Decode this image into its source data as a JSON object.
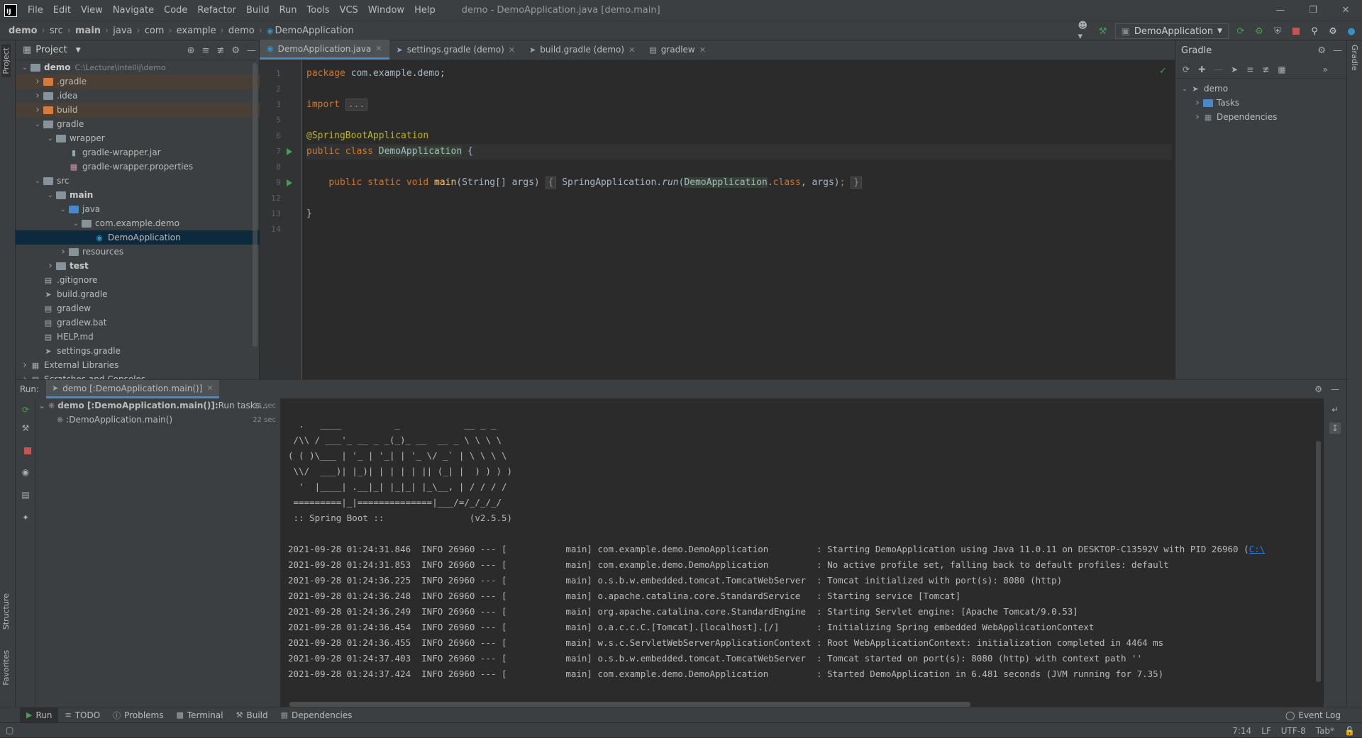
{
  "app": {
    "window_title": "demo - DemoApplication.java [demo.main]"
  },
  "menu": [
    "File",
    "Edit",
    "View",
    "Navigate",
    "Code",
    "Refactor",
    "Build",
    "Run",
    "Tools",
    "VCS",
    "Window",
    "Help"
  ],
  "breadcrumb": [
    "demo",
    "src",
    "main",
    "java",
    "com",
    "example",
    "demo",
    "DemoApplication"
  ],
  "run_config": "DemoApplication",
  "project_panel": {
    "title": "Project",
    "tree": [
      {
        "label": "demo",
        "path": "C:\\Lecture\\intellij\\demo",
        "depth": 0,
        "arrow": "down",
        "icon": "module-folder-icon",
        "bold": true
      },
      {
        "label": ".gradle",
        "depth": 1,
        "arrow": "right",
        "icon": "excluded-folder-icon",
        "excluded": true
      },
      {
        "label": ".idea",
        "depth": 1,
        "arrow": "right",
        "icon": "folder-icon"
      },
      {
        "label": "build",
        "depth": 1,
        "arrow": "right",
        "icon": "excluded-folder-icon",
        "excluded": true
      },
      {
        "label": "gradle",
        "depth": 1,
        "arrow": "down",
        "icon": "folder-icon"
      },
      {
        "label": "wrapper",
        "depth": 2,
        "arrow": "down",
        "icon": "folder-icon"
      },
      {
        "label": "gradle-wrapper.jar",
        "depth": 3,
        "icon": "jar-icon"
      },
      {
        "label": "gradle-wrapper.properties",
        "depth": 3,
        "icon": "properties-icon"
      },
      {
        "label": "src",
        "depth": 1,
        "arrow": "down",
        "icon": "folder-icon"
      },
      {
        "label": "main",
        "depth": 2,
        "arrow": "down",
        "icon": "folder-icon",
        "bold": true
      },
      {
        "label": "java",
        "depth": 3,
        "arrow": "down",
        "icon": "source-folder-icon"
      },
      {
        "label": "com.example.demo",
        "depth": 4,
        "arrow": "down",
        "icon": "package-icon"
      },
      {
        "label": "DemoApplication",
        "depth": 5,
        "icon": "spring-class-icon",
        "selected": true
      },
      {
        "label": "resources",
        "depth": 3,
        "arrow": "right",
        "icon": "resources-folder-icon"
      },
      {
        "label": "test",
        "depth": 2,
        "arrow": "right",
        "icon": "folder-icon",
        "bold": true
      },
      {
        "label": ".gitignore",
        "depth": 1,
        "icon": "file-icon"
      },
      {
        "label": "build.gradle",
        "depth": 1,
        "icon": "gradle-icon"
      },
      {
        "label": "gradlew",
        "depth": 1,
        "icon": "file-icon"
      },
      {
        "label": "gradlew.bat",
        "depth": 1,
        "icon": "file-icon"
      },
      {
        "label": "HELP.md",
        "depth": 1,
        "icon": "markdown-icon"
      },
      {
        "label": "settings.gradle",
        "depth": 1,
        "icon": "gradle-icon"
      },
      {
        "label": "External Libraries",
        "depth": 0,
        "arrow": "right",
        "icon": "libraries-icon"
      },
      {
        "label": "Scratches and Consoles",
        "depth": 0,
        "arrow": "right",
        "icon": "scratches-icon"
      }
    ]
  },
  "editor_tabs": [
    {
      "label": "DemoApplication.java",
      "icon": "spring-class-icon",
      "active": true
    },
    {
      "label": "settings.gradle (demo)",
      "icon": "gradle-icon"
    },
    {
      "label": "build.gradle (demo)",
      "icon": "gradle-icon"
    },
    {
      "label": "gradlew",
      "icon": "file-icon"
    }
  ],
  "code_lines": [
    {
      "n": "1",
      "html": "<span class='kw'>package</span> com.example.demo;"
    },
    {
      "n": "2",
      "html": ""
    },
    {
      "n": "3",
      "html": "<span class='kw'>import</span> <span class='fold-box'>...</span>"
    },
    {
      "n": "5",
      "html": ""
    },
    {
      "n": "6",
      "html": "<span class='ann'>@SpringBootApplication</span>"
    },
    {
      "n": "7",
      "html": "<span class='kw'>public class</span> <span class='hl'>DemoApplication</span> {",
      "run": true,
      "current": true
    },
    {
      "n": "8",
      "html": ""
    },
    {
      "n": "9",
      "html": "    <span class='kw'>public static void</span> <span class='fn'>main</span>(String[] args) <span class='fold-box'>{</span> SpringApplication.<span class='it'>run</span>(<span class='hl'>DemoApplication</span>.<span class='kw'>class</span>, args)<span class='kw'>;</span> <span class='fold-box'>}</span>",
      "run": true
    },
    {
      "n": "12",
      "html": ""
    },
    {
      "n": "13",
      "html": "}"
    },
    {
      "n": "14",
      "html": ""
    }
  ],
  "gradle_panel": {
    "title": "Gradle",
    "tree": [
      {
        "label": "demo",
        "depth": 0,
        "arrow": "down",
        "icon": "gradle-elephant-icon"
      },
      {
        "label": "Tasks",
        "depth": 1,
        "arrow": "right",
        "icon": "tasks-folder-icon"
      },
      {
        "label": "Dependencies",
        "depth": 1,
        "arrow": "right",
        "icon": "dependencies-icon"
      }
    ]
  },
  "run_panel": {
    "label": "Run:",
    "tab": "demo [:DemoApplication.main()]",
    "tree": [
      {
        "label": "demo [:DemoApplication.main()]:",
        "suffix": " Run tasks...",
        "dur": "34 sec",
        "depth": 0
      },
      {
        "label": ":DemoApplication.main()",
        "dur": "22 sec",
        "depth": 1
      }
    ],
    "banner": [
      "  .   ____          _            __ _ _",
      " /\\\\ / ___'_ __ _ _(_)_ __  __ _ \\ \\ \\ \\",
      "( ( )\\___ | '_ | '_| | '_ \\/ _` | \\ \\ \\ \\",
      " \\\\/  ___)| |_)| | | | | || (_| |  ) ) ) )",
      "  '  |____| .__|_| |_|_| |_\\__, | / / / /",
      " =========|_|==============|___/=/_/_/_/",
      " :: Spring Boot ::                (v2.5.5)"
    ],
    "logs": [
      "2021-09-28 01:24:31.846  INFO 26960 --- [           main] com.example.demo.DemoApplication         : Starting DemoApplication using Java 11.0.11 on DESKTOP-C13592V with PID 26960 (",
      "2021-09-28 01:24:31.853  INFO 26960 --- [           main] com.example.demo.DemoApplication         : No active profile set, falling back to default profiles: default",
      "2021-09-28 01:24:36.225  INFO 26960 --- [           main] o.s.b.w.embedded.tomcat.TomcatWebServer  : Tomcat initialized with port(s): 8080 (http)",
      "2021-09-28 01:24:36.248  INFO 26960 --- [           main] o.apache.catalina.core.StandardService   : Starting service [Tomcat]",
      "2021-09-28 01:24:36.249  INFO 26960 --- [           main] org.apache.catalina.core.StandardEngine  : Starting Servlet engine: [Apache Tomcat/9.0.53]",
      "2021-09-28 01:24:36.454  INFO 26960 --- [           main] o.a.c.c.C.[Tomcat].[localhost].[/]       : Initializing Spring embedded WebApplicationContext",
      "2021-09-28 01:24:36.455  INFO 26960 --- [           main] w.s.c.ServletWebServerApplicationContext : Root WebApplicationContext: initialization completed in 4464 ms",
      "2021-09-28 01:24:37.403  INFO 26960 --- [           main] o.s.b.w.embedded.tomcat.TomcatWebServer  : Tomcat started on port(s): 8080 (http) with context path ''",
      "2021-09-28 01:24:37.424  INFO 26960 --- [           main] com.example.demo.DemoApplication         : Started DemoApplication in 6.481 seconds (JVM running for 7.35)"
    ],
    "first_log_link": "C:\\"
  },
  "bottom_tabs": [
    {
      "label": "Run",
      "icon": "run-icon",
      "active": true
    },
    {
      "label": "TODO",
      "icon": "todo-icon"
    },
    {
      "label": "Problems",
      "icon": "problems-icon"
    },
    {
      "label": "Terminal",
      "icon": "terminal-icon"
    },
    {
      "label": "Build",
      "icon": "build-icon"
    },
    {
      "label": "Dependencies",
      "icon": "dependencies-icon"
    }
  ],
  "event_log": "Event Log",
  "status": {
    "position": "7:14",
    "line_sep": "LF",
    "encoding": "UTF-8",
    "indent": "Tab*"
  },
  "stripe_labels": {
    "project": "Project",
    "structure": "Structure",
    "favorites": "Favorites",
    "gradle": "Gradle"
  },
  "colors": {
    "accent": "#4a88c7",
    "run_green": "#499c54",
    "stop_red": "#c75450",
    "excluded_bg": "#4a3f34",
    "selected_bg": "#0d293e"
  }
}
